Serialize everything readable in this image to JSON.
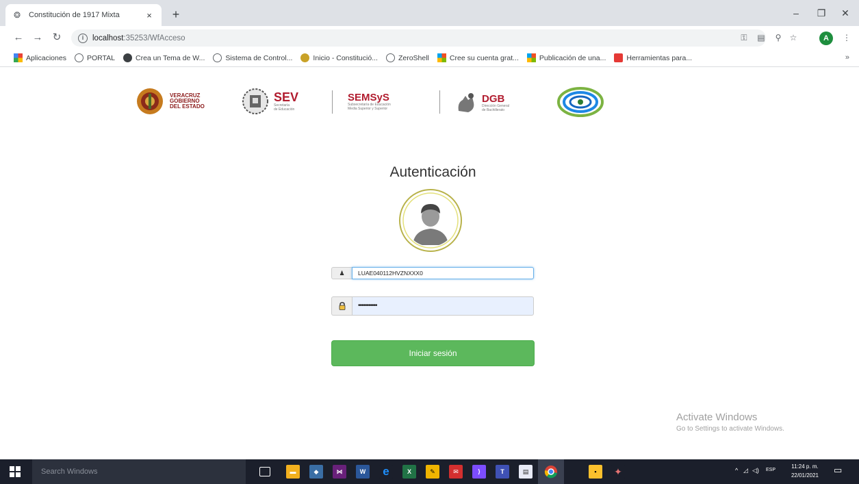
{
  "browser": {
    "tab_title": "Constitución de 1917 Mixta",
    "tab_close": "×",
    "new_tab": "+",
    "window_buttons": [
      "–",
      "❐",
      "✕"
    ],
    "url_host": "localhost",
    "url_path": ":35253/WfAcceso",
    "profile_initial": "A",
    "bookmarks": [
      {
        "label": "Aplicaciones",
        "icon": "apps-grid-icon"
      },
      {
        "label": "PORTAL",
        "icon": "globe-icon"
      },
      {
        "label": "Crea un Tema de W...",
        "icon": "wordpress-icon"
      },
      {
        "label": "Sistema de Control...",
        "icon": "globe-icon"
      },
      {
        "label": "Inicio - Constitució...",
        "icon": "school-crest-icon"
      },
      {
        "label": "ZeroShell",
        "icon": "globe-icon"
      },
      {
        "label": "Cree su cuenta grat...",
        "icon": "microsoft-icon"
      },
      {
        "label": "Publicación de una...",
        "icon": "microsoft-icon"
      },
      {
        "label": "Herramientas para...",
        "icon": "toolbox-icon"
      }
    ],
    "bookmarks_more": "»"
  },
  "logos": {
    "veracruz": {
      "line1": "VERACRUZ",
      "line2": "GOBIERNO",
      "line3": "DEL ESTADO"
    },
    "sev": {
      "title": "SEV",
      "sub1": "Secretaría",
      "sub2": "de Educación"
    },
    "semsys": {
      "title": "SEMSyS",
      "sub1": "Subsecretaría de Educación",
      "sub2": "Media Superior y Superior"
    },
    "dgb": {
      "title": "DGB",
      "sub1": "Dirección General",
      "sub2": "de Bachillerato"
    }
  },
  "login": {
    "title": "Autenticación",
    "username_value": "LUAE040112HVZNXXX0",
    "password_mask": "•••••••••••",
    "submit_label": "Iniciar sesión"
  },
  "watermark": {
    "line1": "Activate Windows",
    "line2": "Go to Settings to activate Windows."
  },
  "taskbar": {
    "search_placeholder": "Search Windows",
    "language": "ESP",
    "time": "11:24 p. m.",
    "date": "22/01/2021"
  },
  "colors": {
    "login_button": "#5cb85c",
    "taskbar": "#1b1f2b",
    "avatar_ring": "#b8b24a",
    "profile": "#1e8e3e"
  }
}
